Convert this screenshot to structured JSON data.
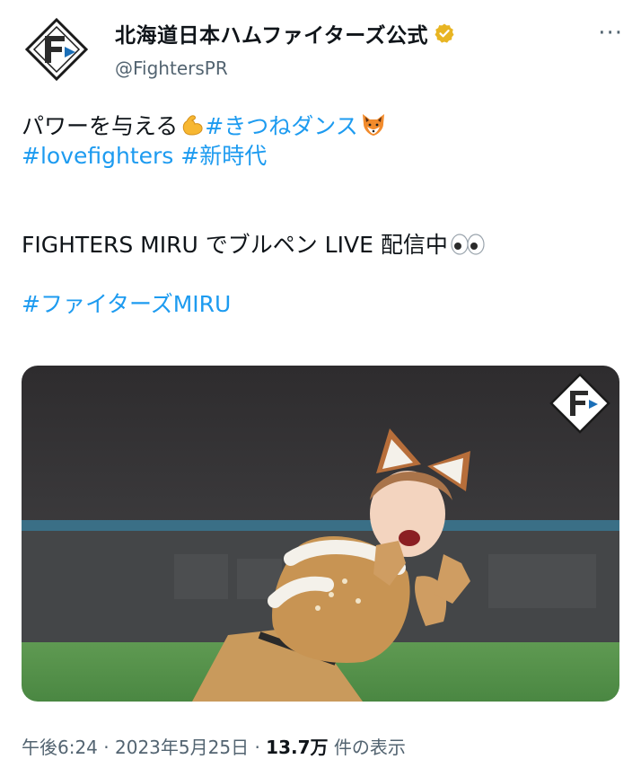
{
  "account": {
    "display_name": "北海道日本ハムファイターズ公式",
    "handle": "@FightersPR",
    "avatar_icon": "fighters-logo-icon",
    "verified_icon": "verified-badge-icon",
    "more_label": "···"
  },
  "tweet": {
    "line1_text": "パワーを与える",
    "line1_hashtag": "#きつねダンス",
    "line2_hashtag1": "#lovefighters",
    "line2_hashtag2": "#新時代",
    "line3_text": "FIGHTERS MIRU でブルペン LIVE 配信中",
    "line4_hashtag": "#ファイターズMIRU",
    "emojis": [
      "flexed-biceps-icon",
      "fox-face-icon",
      "eyes-icon"
    ]
  },
  "media": {
    "watermark_icon": "fighters-logo-icon",
    "subject": "fox-dance-performer-image"
  },
  "meta": {
    "time": "午後6:24",
    "separator": "·",
    "date": "2023年5月25日",
    "views_count": "13.7万",
    "views_label": "件の表示"
  },
  "colors": {
    "link": "#1d9bf0",
    "text": "#0f1419",
    "secondary": "#536471",
    "verified": "#e8b523"
  }
}
